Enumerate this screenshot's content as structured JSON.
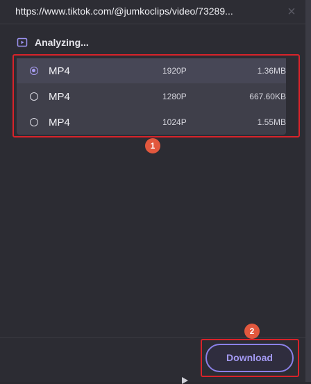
{
  "dialog": {
    "url": "https://www.tiktok.com/@jumkoclips/video/73289...",
    "close_icon": "close-icon"
  },
  "status": {
    "icon": "video-icon",
    "text": "Analyzing..."
  },
  "formats": [
    {
      "format": "MP4",
      "resolution": "1920P",
      "size": "1.36MB",
      "selected": true
    },
    {
      "format": "MP4",
      "resolution": "1280P",
      "size": "667.60KB",
      "selected": false
    },
    {
      "format": "MP4",
      "resolution": "1024P",
      "size": "1.55MB",
      "selected": false
    }
  ],
  "annotations": {
    "badge1": "1",
    "badge2": "2"
  },
  "footer": {
    "download_label": "Download"
  },
  "colors": {
    "accent": "#8b80e8",
    "highlight": "#d8232a",
    "badge": "#e2583e"
  }
}
